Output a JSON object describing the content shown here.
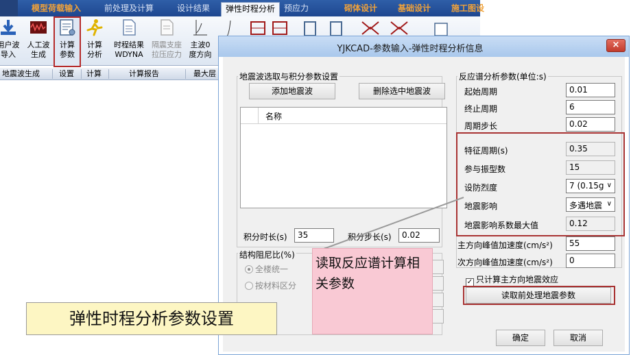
{
  "ribbon": {
    "tabs": [
      "模型荷载输入",
      "前处理及计算",
      "设计结果",
      "弹性时程分析",
      "预应力",
      "砌体设计",
      "基础设计",
      "施工图设"
    ],
    "buttons": [
      {
        "line1": "用户波",
        "line2": "导入"
      },
      {
        "line1": "人工波",
        "line2": "生成"
      },
      {
        "line1": "计算",
        "line2": "参数"
      },
      {
        "line1": "计算",
        "line2": "分析"
      },
      {
        "line1": "时程结果",
        "line2": "WDYNA"
      },
      {
        "line1": "隔震支座",
        "line2": "拉压应力"
      },
      {
        "line1": "主波0",
        "line2": "度方向"
      }
    ],
    "groups": [
      "地震波生成",
      "设置",
      "计算",
      "计算报告",
      "最大层"
    ]
  },
  "dialog": {
    "title": "YJKCAD-参数输入-弹性时程分析信息",
    "close_glyph": "×",
    "wave_group": {
      "title": "地震波选取与积分参数设置",
      "add_button": "添加地震波",
      "delete_button": "删除选中地震波",
      "list_header": "名称",
      "duration_label": "积分时长(s)",
      "duration_value": "35",
      "step_label": "积分步长(s)",
      "step_value": "0.02"
    },
    "damping_group": {
      "title": "结构阻尼比(%)",
      "option_uniform": "全楼统一",
      "option_material": "按材料区分"
    },
    "spectrum_group": {
      "title": "反应谱分析参数(单位:s)",
      "start_period_label": "起始周期",
      "start_period_value": "0.01",
      "end_period_label": "终止周期",
      "end_period_value": "6",
      "period_step_label": "周期步长",
      "period_step_value": "0.02",
      "char_period_label": "特征周期(s)",
      "char_period_value": "0.35",
      "modes_label": "参与振型数",
      "modes_value": "15",
      "intensity_label": "设防烈度",
      "intensity_value": "7 (0.15g",
      "influence_label": "地震影响",
      "influence_value": "多遇地震",
      "max_coef_label": "地震影响系数最大值",
      "max_coef_value": "0.12"
    },
    "main_pga_label": "主方向峰值加速度(cm/s²)",
    "main_pga_value": "55",
    "sub_pga_label": "次方向峰值加速度(cm/s²)",
    "sub_pga_value": "0",
    "main_only_label": "只计算主方向地震效应",
    "read_button": "读取前处理地震参数",
    "ok_button": "确定",
    "cancel_button": "取消"
  },
  "annotations": {
    "pink_note": "读取反应谱计算相关参数",
    "banner": "弹性时程分析参数设置"
  },
  "colors": {
    "highlight": "#a83232",
    "ribbon": "#2f5fa8",
    "note": "#f9c9d4",
    "banner": "#fdf6c3"
  }
}
